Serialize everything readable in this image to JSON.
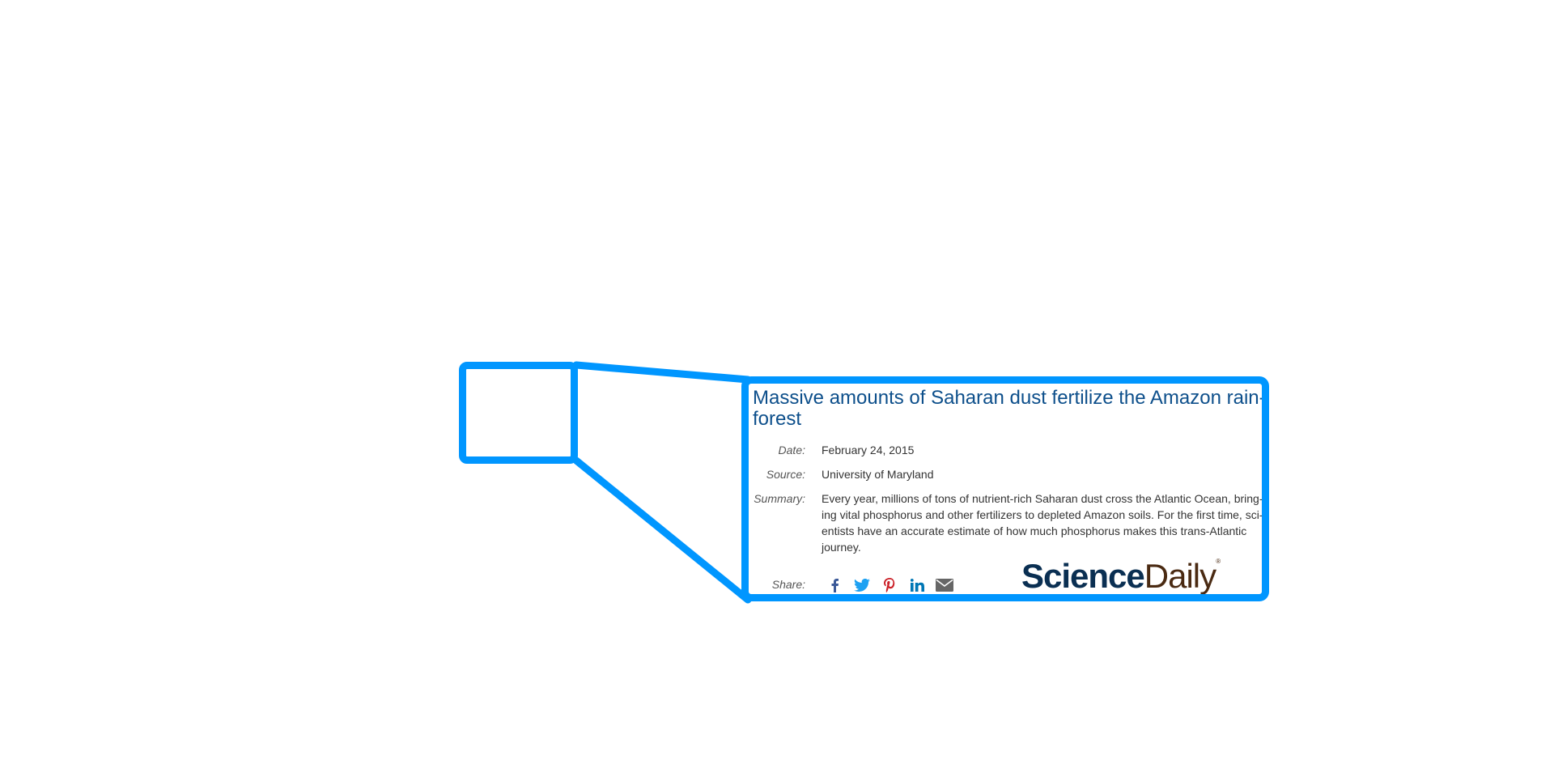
{
  "colors": {
    "callout_border": "#0096ff",
    "headline": "#0d4f8b",
    "logo_science": "#0a2f52",
    "logo_daily": "#4a2a12",
    "facebook": "#3b5998",
    "twitter": "#1da1f2",
    "pinterest": "#cb2027",
    "linkedin": "#0077b5",
    "email": "#666666"
  },
  "article": {
    "headline_lines": [
      "Massive amounts of Saharan dust fertilize the Amazon rain-",
      "forest"
    ],
    "date_label": "Date:",
    "date_value": "February 24, 2015",
    "source_label": "Source:",
    "source_value": "University of Maryland",
    "summary_label": "Summary:",
    "summary_lines": [
      "Every year, millions of tons of nutrient-rich Saharan dust cross the Atlantic Ocean, bring-",
      "ing vital phosphorus and other fertilizers to depleted Amazon soils. For the first time, sci-",
      "entists have an accurate estimate of how much phosphorus makes this trans-Atlantic",
      "journey."
    ],
    "share_label": "Share:",
    "share_icons": [
      "facebook-icon",
      "twitter-icon",
      "pinterest-icon",
      "linkedin-icon",
      "email-icon"
    ]
  },
  "logo": {
    "part1": "Science",
    "part2": "Daily",
    "mark": "®"
  }
}
